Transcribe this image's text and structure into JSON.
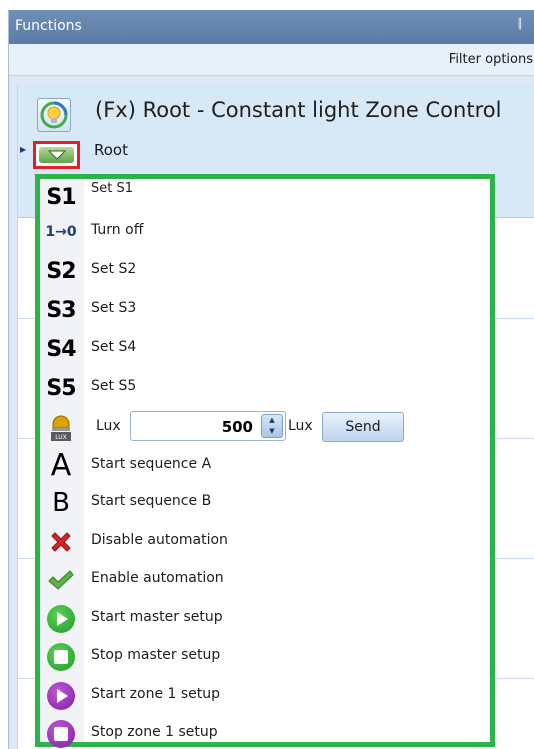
{
  "panel": {
    "title": "Functions",
    "pin_icon": "pin-icon",
    "filter_options": "Filter options"
  },
  "root_node": {
    "title": "(Fx) Root - Constant light Zone Control",
    "sub_label": "Root",
    "icon": "constant-light-bulb-icon"
  },
  "menu": {
    "border_color": "#2db34a",
    "items": [
      {
        "icon_text": "S1",
        "label": "Set S1"
      },
      {
        "icon_text": "1→0",
        "label": "Turn off"
      },
      {
        "icon_text": "S2",
        "label": "Set S2"
      },
      {
        "icon_text": "S3",
        "label": "Set S3"
      },
      {
        "icon_text": "S4",
        "label": "Set S4"
      },
      {
        "icon_text": "S5",
        "label": "Set S5"
      }
    ],
    "lux": {
      "label": "Lux",
      "value": "500",
      "unit": "Lux",
      "send": "Send",
      "icon_text": "LUX"
    },
    "actions": [
      {
        "icon_text": "A",
        "label": "Start sequence A"
      },
      {
        "icon_text": "B",
        "label": "Start sequence B"
      },
      {
        "icon": "red-x-icon",
        "label": "Disable automation"
      },
      {
        "icon": "green-check-icon",
        "label": "Enable automation"
      },
      {
        "icon": "green-play-icon",
        "label": "Start master setup"
      },
      {
        "icon": "green-stop-icon",
        "label": "Stop master setup"
      },
      {
        "icon": "purple-play-icon",
        "label": "Start zone 1 setup"
      },
      {
        "icon": "purple-stop-icon",
        "label": "Stop zone 1 setup"
      }
    ]
  },
  "colors": {
    "highlight_red": "#e0202a",
    "highlight_green": "#2db34a",
    "titlebar": "#6f8fb6"
  }
}
